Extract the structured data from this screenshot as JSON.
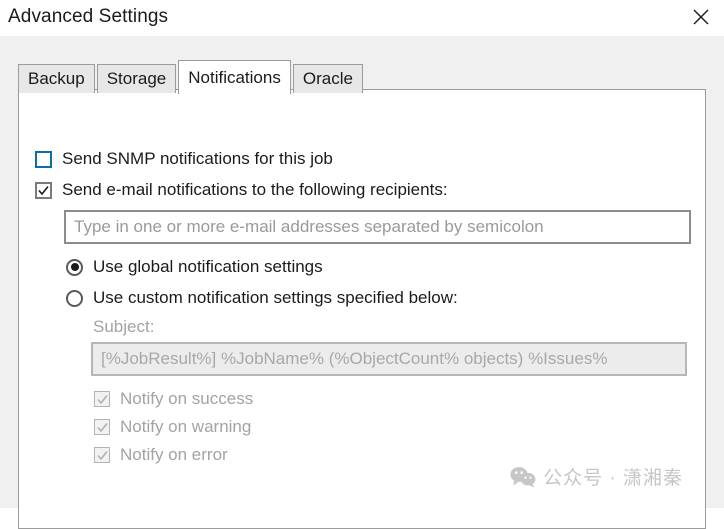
{
  "window": {
    "title": "Advanced Settings",
    "close_icon": "close-icon"
  },
  "tabs": [
    {
      "label": "Backup",
      "active": false
    },
    {
      "label": "Storage",
      "active": false
    },
    {
      "label": "Notifications",
      "active": true
    },
    {
      "label": "Oracle",
      "active": false
    }
  ],
  "notifications": {
    "snmp": {
      "label": "Send SNMP notifications for this job",
      "checked": false,
      "focused": true
    },
    "email": {
      "label": "Send e-mail notifications to the following recipients:",
      "checked": true
    },
    "recipients_input": {
      "value": "",
      "placeholder": "Type in one or more e-mail addresses separated by semicolon"
    },
    "mode_options": [
      {
        "label": "Use global notification settings",
        "selected": true
      },
      {
        "label": "Use custom notification settings specified below:",
        "selected": false
      }
    ],
    "subject": {
      "label": "Subject:",
      "value": "[%JobResult%] %JobName% (%ObjectCount% objects) %Issues%",
      "disabled": true
    },
    "notify_options": [
      {
        "label": "Notify on success",
        "checked": true,
        "disabled": true
      },
      {
        "label": "Notify on warning",
        "checked": true,
        "disabled": true
      },
      {
        "label": "Notify on error",
        "checked": true,
        "disabled": true
      }
    ]
  },
  "watermark": {
    "icon": "wechat-icon",
    "text": "公众号 · 潇湘秦"
  },
  "colors": {
    "focus_blue": "#0a6ead",
    "dialog_gray": "#f0f0f0",
    "border_gray": "#9b9b9b",
    "disabled_text": "#a3a3a3"
  }
}
